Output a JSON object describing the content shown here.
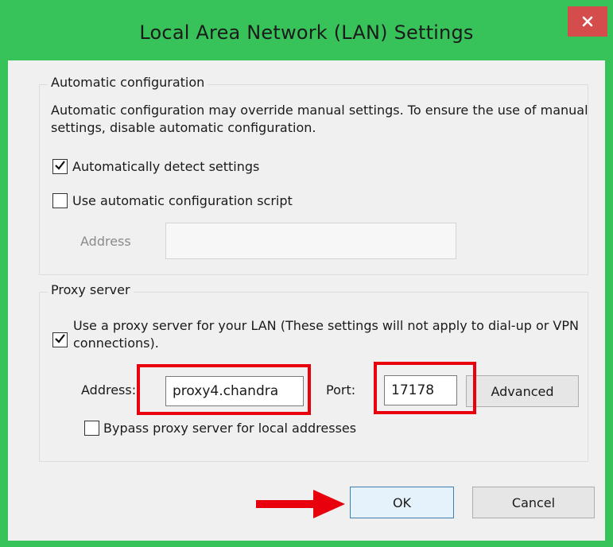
{
  "window": {
    "title": "Local Area Network (LAN) Settings",
    "close_icon": "close-icon"
  },
  "automatic_configuration": {
    "legend": "Automatic configuration",
    "description": "Automatic configuration may override manual settings.  To ensure the use of manual settings, disable automatic configuration.",
    "detect_settings": {
      "label": "Automatically detect settings",
      "checked": true
    },
    "use_script": {
      "label": "Use automatic configuration script",
      "checked": false
    },
    "address_label": "Address",
    "address_value": ""
  },
  "proxy_server": {
    "legend": "Proxy server",
    "use_proxy": {
      "label": "Use a proxy server for your LAN (These settings will not apply to dial-up or VPN connections).",
      "checked": true
    },
    "address_label": "Address:",
    "address_value": "proxy4.chandra",
    "port_label": "Port:",
    "port_value": "17178",
    "advanced_label": "Advanced",
    "bypass": {
      "label": "Bypass proxy server for local addresses",
      "checked": false
    }
  },
  "buttons": {
    "ok_label": "OK",
    "cancel_label": "Cancel"
  },
  "colors": {
    "titlebar": "#38c35a",
    "close_button": "#d44c4b",
    "annotation_red": "#e8000c"
  }
}
